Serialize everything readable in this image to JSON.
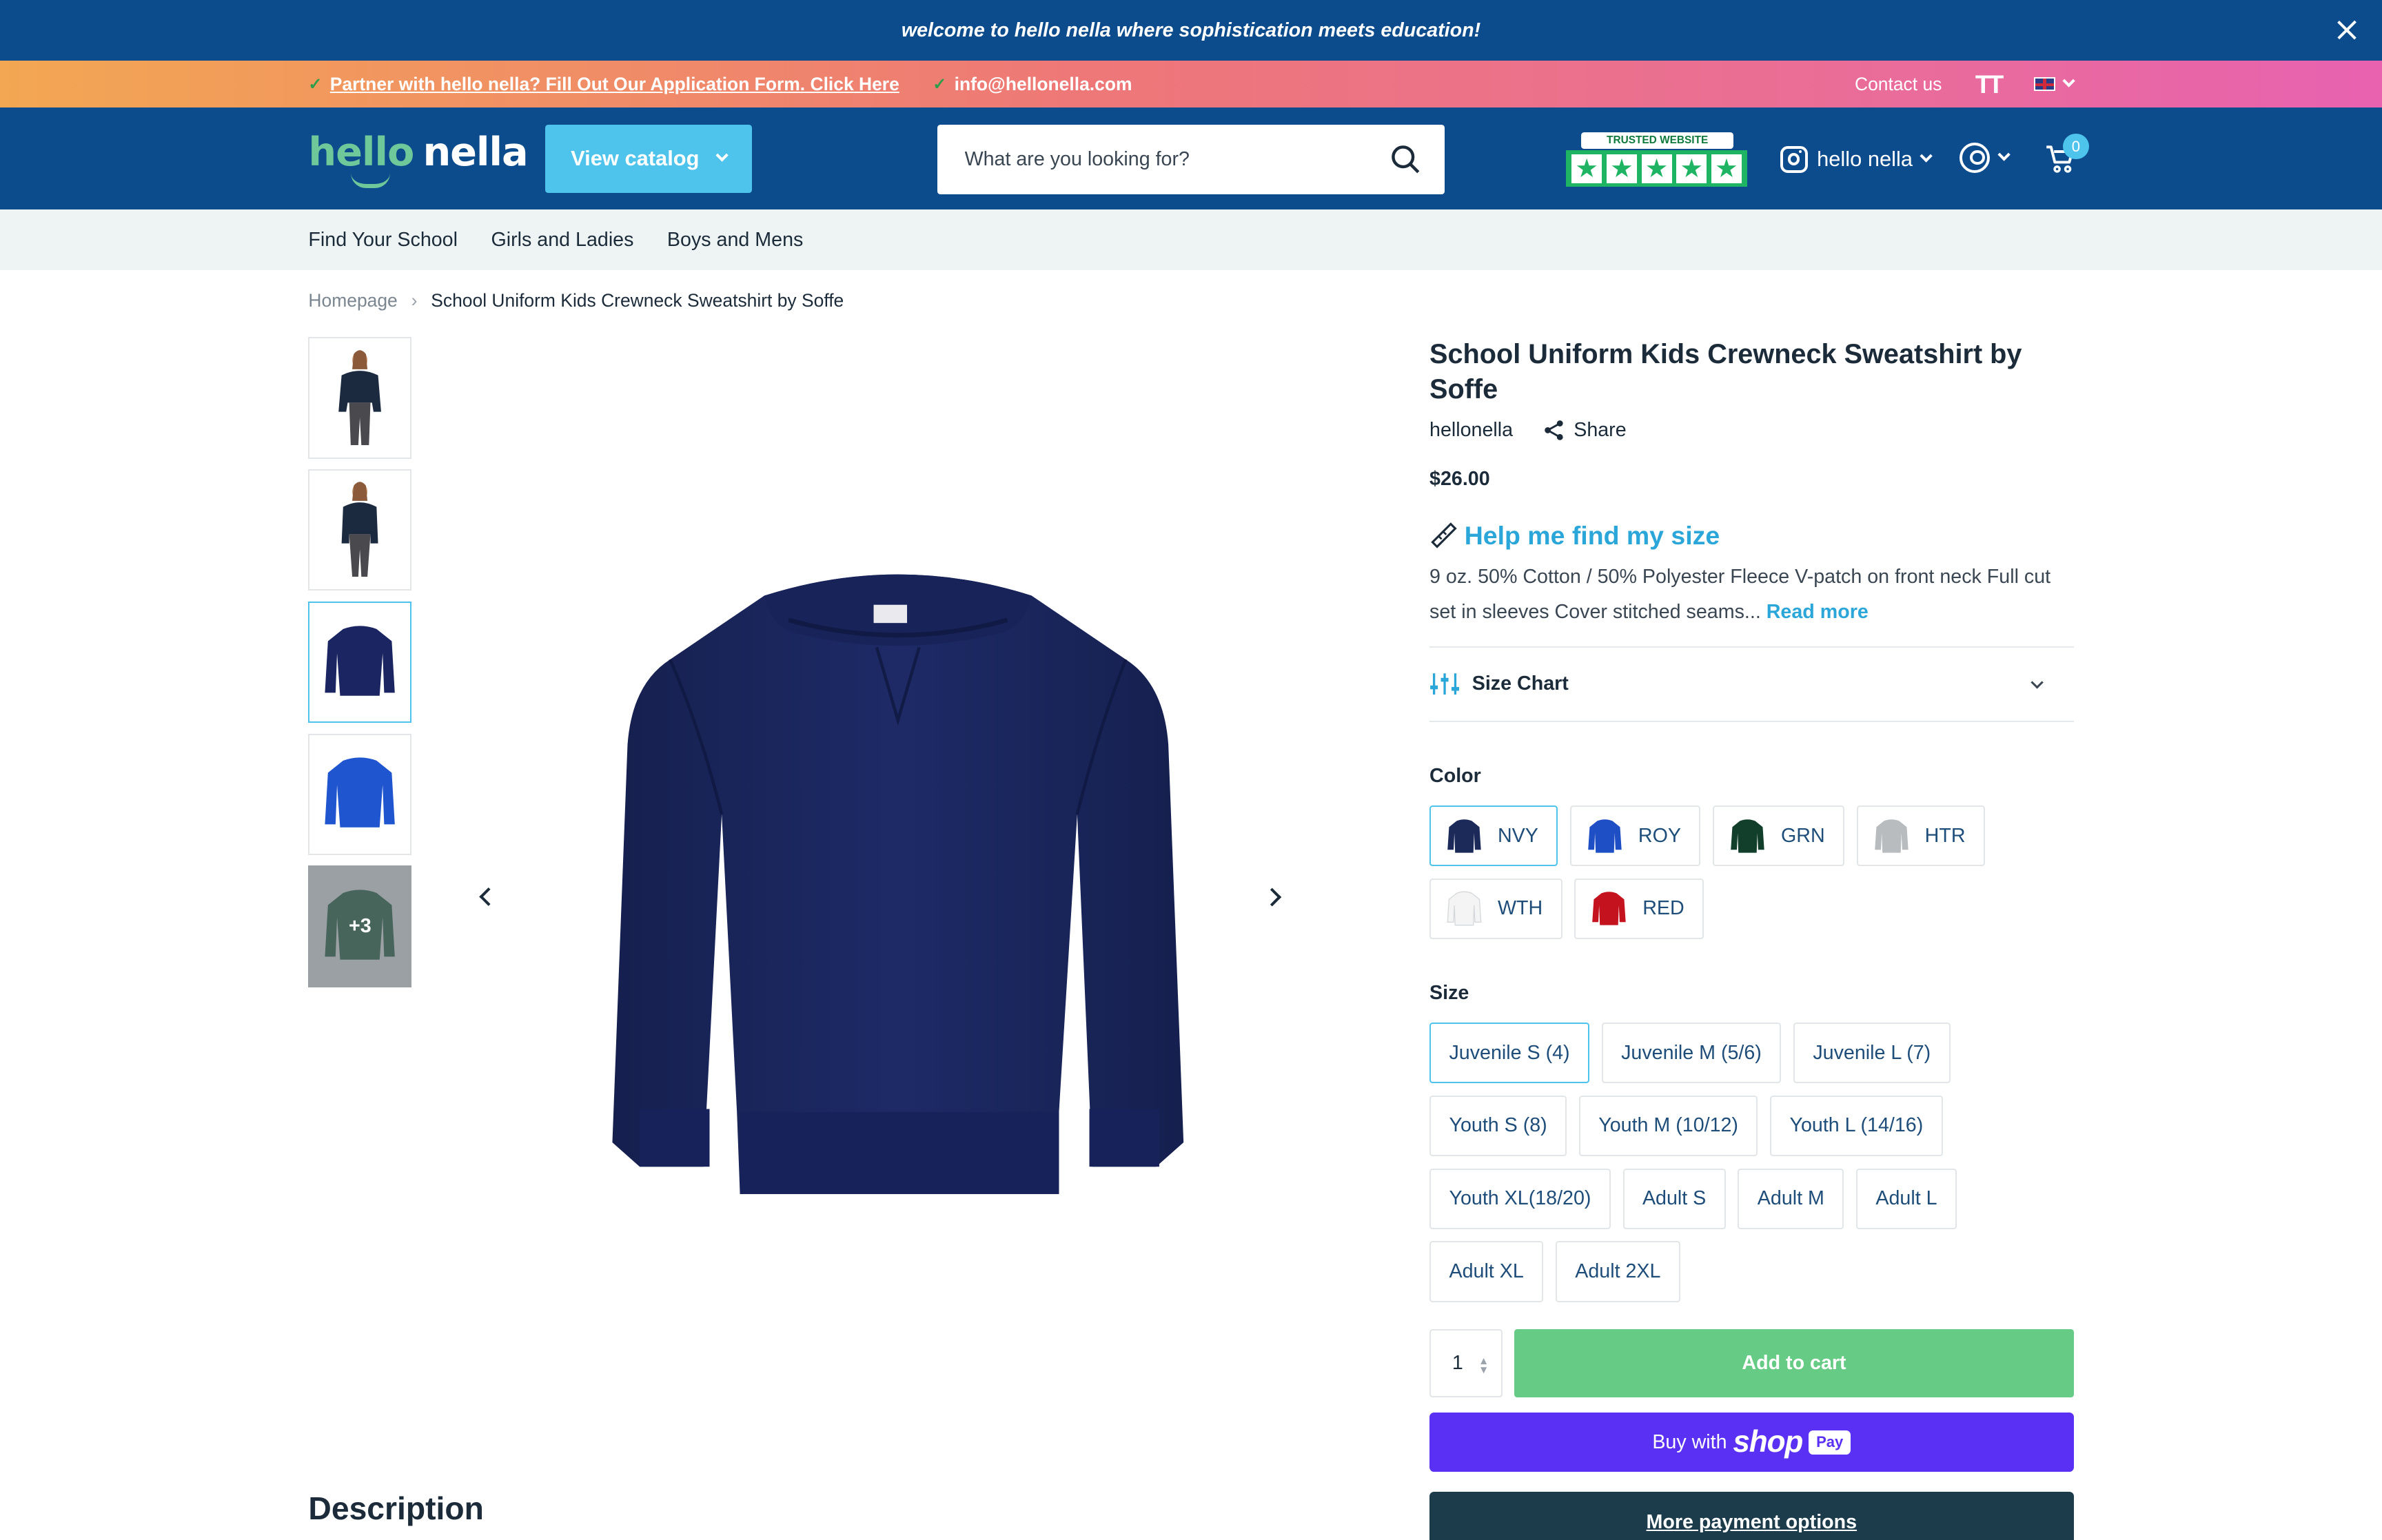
{
  "announcement": {
    "text": "welcome to hello nella where sophistication meets education!"
  },
  "promo": {
    "partner_link": "Partner with hello nella? Fill Out Our Application Form. Click Here",
    "email": "info@hellonella.com",
    "contact": "Contact us"
  },
  "header": {
    "logo_hello": "hello",
    "logo_nella": "nella",
    "catalog_label": "View catalog",
    "search_placeholder": "What are you looking for?",
    "trusted_label": "TRUSTED WEBSITE",
    "instagram_label": "hello nella",
    "cart_count": "0"
  },
  "nav": {
    "items": [
      "Find Your School",
      "Girls and Ladies",
      "Boys and Mens"
    ]
  },
  "breadcrumb": {
    "home": "Homepage",
    "current": "School Uniform Kids Crewneck Sweatshirt by Soffe"
  },
  "gallery": {
    "more_count": "+3"
  },
  "product": {
    "title": "School Uniform Kids Crewneck Sweatshirt by Soffe",
    "vendor": "hellonella",
    "share_label": "Share",
    "price": "$26.00",
    "help_label": "Help me find my size",
    "description": "9 oz. 50% Cotton / 50% Polyester Fleece V-patch on front neck Full cut set in sleeves Cover stitched seams...",
    "read_more": "Read more",
    "size_chart_label": "Size Chart",
    "color_label": "Color",
    "colors": [
      {
        "code": "NVY",
        "hex": "#1c2a5a"
      },
      {
        "code": "ROY",
        "hex": "#1f4fc4"
      },
      {
        "code": "GRN",
        "hex": "#123f2c"
      },
      {
        "code": "HTR",
        "hex": "#b9bcbf"
      },
      {
        "code": "WTH",
        "hex": "#f4f4f4"
      },
      {
        "code": "RED",
        "hex": "#c4131f"
      }
    ],
    "selected_color": "NVY",
    "size_label": "Size",
    "sizes": [
      "Juvenile S (4)",
      "Juvenile M (5/6)",
      "Juvenile L (7)",
      "Youth S (8)",
      "Youth M (10/12)",
      "Youth L (14/16)",
      "Youth XL(18/20)",
      "Adult S",
      "Adult M",
      "Adult L",
      "Adult XL",
      "Adult 2XL"
    ],
    "selected_size": "Juvenile S (4)",
    "quantity": "1",
    "add_to_cart": "Add to cart",
    "buy_with": "Buy with",
    "shop_word": "shop",
    "pay_word": "Pay",
    "more_payment": "More payment options"
  },
  "description_heading": "Description",
  "colors": {
    "header_bg": "#0c4b8c",
    "accent": "#4ec4ec",
    "add_to_cart": "#66cb84",
    "shop_pay": "#5a31f4"
  }
}
